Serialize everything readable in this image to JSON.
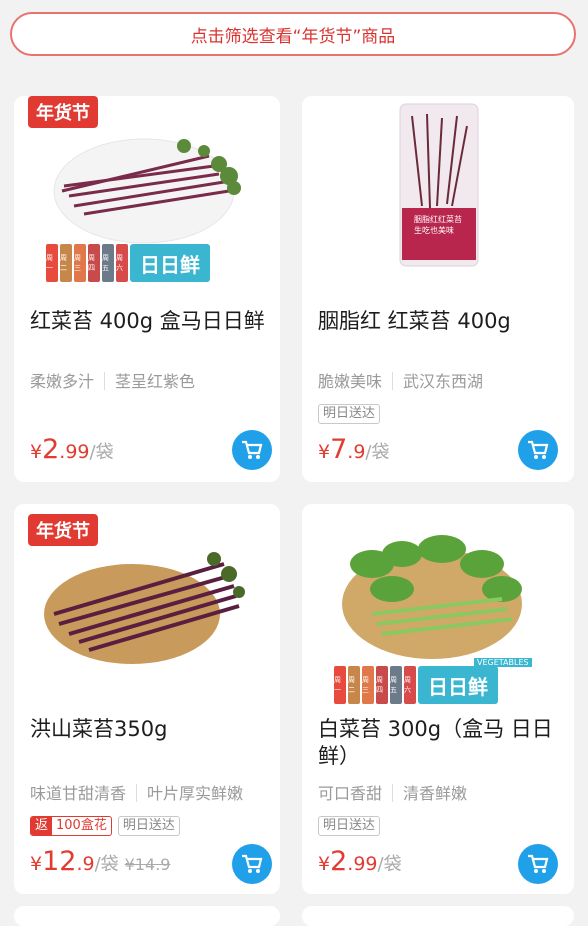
{
  "filter": {
    "label": "点击筛选查看“年货节”商品"
  },
  "strip": {
    "days": [
      "周一",
      "周二",
      "周三",
      "周四",
      "周五",
      "周六"
    ],
    "day_colors": [
      "#e84a3d",
      "#c7874b",
      "#e0784a",
      "#c84a4a",
      "#6c7a8a",
      "#d84b4b"
    ],
    "brand": "日日鲜"
  },
  "products": [
    {
      "badge": "年货节",
      "title": "红菜苔 400g 盒马日日鲜",
      "tags": [
        "柔嫩多汁",
        "茎呈红紫色"
      ],
      "pills": [],
      "price": {
        "currency": "¥",
        "int": "2",
        "dec": ".99",
        "unit": "/袋",
        "old": ""
      }
    },
    {
      "badge": "",
      "title": "胭脂红 红菜苔 400g",
      "tags": [
        "脆嫩美味",
        "武汉东西湖"
      ],
      "pills": [
        "明日送达"
      ],
      "price": {
        "currency": "¥",
        "int": "7",
        "dec": ".9",
        "unit": "/袋",
        "old": ""
      }
    },
    {
      "badge": "年货节",
      "title": "洪山菜苔350g",
      "tags": [
        "味道甘甜清香",
        "叶片厚实鲜嫩"
      ],
      "fanli": {
        "label": "返",
        "value": "100盒花"
      },
      "pills": [
        "明日送达"
      ],
      "price": {
        "currency": "¥",
        "int": "12",
        "dec": ".9",
        "unit": "/袋",
        "old": "¥14.9"
      }
    },
    {
      "badge": "",
      "title": "白菜苔 300g（盒马 日日鲜）",
      "tags": [
        "可口香甜",
        "清香鲜嫩"
      ],
      "pills": [
        "明日送达"
      ],
      "price": {
        "currency": "¥",
        "int": "2",
        "dec": ".99",
        "unit": "/袋",
        "old": ""
      }
    }
  ],
  "package_label": {
    "line1": "胭脂红红菜苔",
    "line2": "生吃也美味"
  },
  "basket_label": "VEGETABLES",
  "colors": {
    "accent_red": "#e03a33",
    "cart_blue": "#1fa0e9",
    "price_red": "#e23b30"
  },
  "icons": [
    "cart-icon"
  ]
}
